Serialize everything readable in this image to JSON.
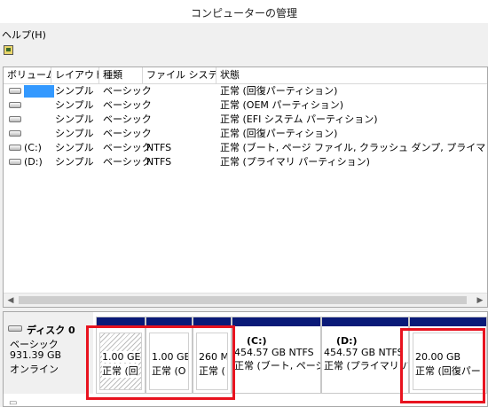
{
  "window": {
    "title": "コンピューターの管理"
  },
  "menu": {
    "help": "ヘルプ(H)"
  },
  "toolbar": {
    "icon": "disk-properties-icon"
  },
  "volume_list": {
    "columns": [
      "ボリューム",
      "レイアウト",
      "種類",
      "ファイル システム",
      "状態"
    ],
    "rows": [
      {
        "volume": "",
        "layout": "シンプル",
        "type": "ベーシック",
        "fs": "",
        "status": "正常 (回復パーティション)"
      },
      {
        "volume": "",
        "layout": "シンプル",
        "type": "ベーシック",
        "fs": "",
        "status": "正常 (OEM パーティション)"
      },
      {
        "volume": "",
        "layout": "シンプル",
        "type": "ベーシック",
        "fs": "",
        "status": "正常 (EFI システム パーティション)"
      },
      {
        "volume": "",
        "layout": "シンプル",
        "type": "ベーシック",
        "fs": "",
        "status": "正常 (回復パーティション)"
      },
      {
        "volume": "(C:)",
        "layout": "シンプル",
        "type": "ベーシック",
        "fs": "NTFS",
        "status": "正常 (ブート, ページ ファイル, クラッシュ ダンプ, プライマリ パーティション)"
      },
      {
        "volume": "(D:)",
        "layout": "シンプル",
        "type": "ベーシック",
        "fs": "NTFS",
        "status": "正常 (プライマリ パーティション)"
      }
    ]
  },
  "disk0": {
    "name": "ディスク 0",
    "kind": "ベーシック",
    "size": "931.39 GB",
    "state": "オンライン",
    "partitions": [
      {
        "label": "",
        "size": "1.00 GE",
        "status": "正常 (回"
      },
      {
        "label": "",
        "size": "1.00 GE",
        "status": "正常 (O"
      },
      {
        "label": "",
        "size": "260 M",
        "status": "正常 ("
      },
      {
        "label": "(C:)",
        "size": "454.57 GB NTFS",
        "status": "正常 (ブート, ページ"
      },
      {
        "label": "(D:)",
        "size": "454.57 GB NTFS",
        "status": "正常 (プライマリ パ"
      },
      {
        "label": "",
        "size": "20.00 GB",
        "status": "正常 (回復パー"
      }
    ]
  },
  "colors": {
    "highlight": "#e8131f",
    "partition_bar": "#0a1a78",
    "selection": "#3399ff"
  }
}
